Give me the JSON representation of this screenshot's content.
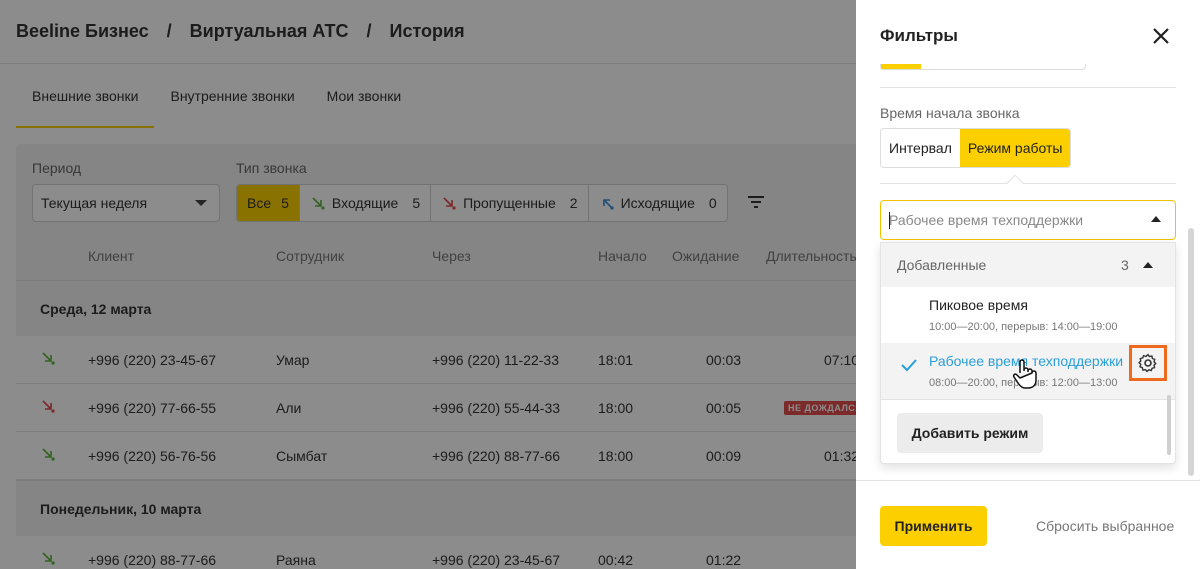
{
  "breadcrumb": [
    "Beeline Бизнес",
    "Виртуальная АТС",
    "История"
  ],
  "breadcrumb_sep": "/",
  "tabs": [
    "Внешние звонки",
    "Внутренние звонки",
    "Мои звонки"
  ],
  "filters": {
    "period_label": "Период",
    "period_value": "Текущая неделя",
    "type_label": "Тип звонка",
    "types": [
      {
        "label": "Все",
        "count": "5"
      },
      {
        "label": "Входящие",
        "count": "5"
      },
      {
        "label": "Пропущенные",
        "count": "2"
      },
      {
        "label": "Исходящие",
        "count": "0"
      }
    ]
  },
  "table": {
    "headers": [
      "Клиент",
      "Сотрудник",
      "Через",
      "Начало",
      "Ожидание",
      "Длительность"
    ],
    "groups": [
      {
        "title": "Среда, 12 марта",
        "rows": [
          {
            "client": "+996 (220) 23-45-67",
            "employee": "Умар",
            "via": "+996 (220) 11-22-33",
            "start": "18:01",
            "wait": "00:03",
            "duration": "07:10",
            "status": "incoming"
          },
          {
            "client": "+996 (220) 77-66-55",
            "employee": "Али",
            "via": "+996 (220) 55-44-33",
            "start": "18:00",
            "wait": "00:05",
            "duration": "НЕ ДОЖДАЛСЯ",
            "status": "missed"
          },
          {
            "client": "+996 (220) 56-76-56",
            "employee": "Сымбат",
            "via": "+996 (220) 88-77-66",
            "start": "18:00",
            "wait": "00:09",
            "duration": "01:32",
            "status": "incoming"
          }
        ]
      },
      {
        "title": "Понедельник, 10 марта",
        "rows": [
          {
            "client": "+996 (220) 88-77-66",
            "employee": "Раяна",
            "via": "+996 (220) 23-45-67",
            "start": "00:42",
            "wait": "01:22",
            "duration": "",
            "status": "incoming"
          }
        ]
      }
    ]
  },
  "panel": {
    "title": "Фильтры",
    "section_label": "Время начала звонка",
    "modes": [
      "Интервал",
      "Режим работы"
    ],
    "active_mode": "Режим работы",
    "combo_value": "Рабочее время техподдержки",
    "dropdown": {
      "group_label": "Добавленные",
      "group_count": "3",
      "options": [
        {
          "name": "Пиковое время",
          "sub": "10:00—20:00, перерыв: 14:00—19:00",
          "selected": false
        },
        {
          "name": "Рабочее время техподдержки",
          "sub": "08:00—20:00, перерыв: 12:00—13:00",
          "selected": true
        }
      ],
      "add_label": "Добавить режим"
    },
    "apply_label": "Применить",
    "reset_label": "Сбросить выбранное"
  },
  "colors": {
    "accent": "#fcd000",
    "link": "#2a9fd8",
    "highlight": "#ef6a1c",
    "incoming": "#5bb53b",
    "missed": "#e04b4b",
    "outgoing": "#3a8fd8"
  }
}
